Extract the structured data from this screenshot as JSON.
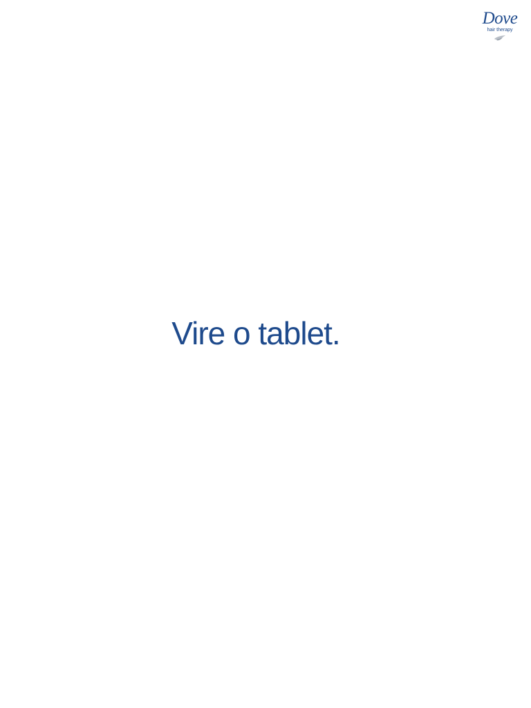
{
  "brand": {
    "name": "Dove",
    "tagline": "hair therapy",
    "icon": "dove-bird-icon",
    "color": "#1e4a8c"
  },
  "message": "Vire o tablet."
}
